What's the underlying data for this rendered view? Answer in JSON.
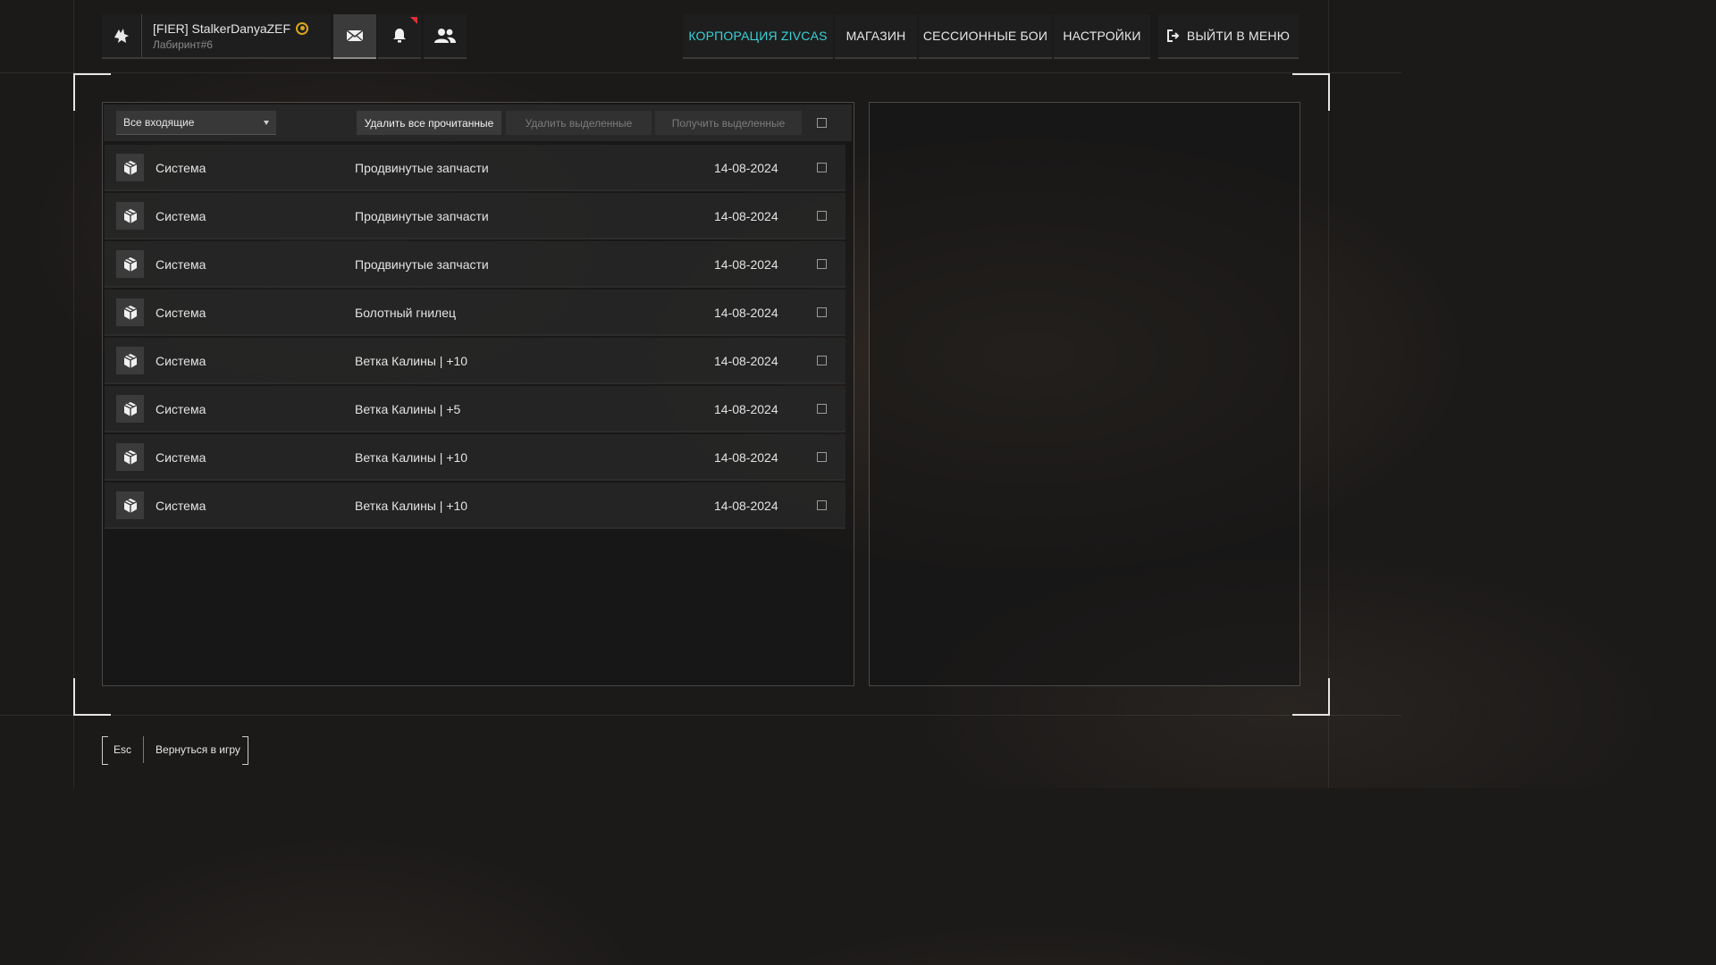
{
  "profile": {
    "name": "[FIER] StalkerDanyaZEF",
    "subtitle": "Лабиринт#6"
  },
  "top_icons": [
    "mail-icon",
    "bell-icon",
    "friends-icon"
  ],
  "nav": {
    "corporation": "КОРПОРАЦИЯ ZIVCAS",
    "shop": "МАГАЗИН",
    "sessions": "СЕССИОННЫЕ БОИ",
    "settings": "НАСТРОЙКИ",
    "exit": "ВЫЙТИ В МЕНЮ"
  },
  "colors": {
    "accent": "#3ad0d6",
    "badge": "#e0303a",
    "gold": "#d9a520"
  },
  "mail": {
    "filter": "Все входящие",
    "delete_read": "Удалить все прочитанные",
    "delete_selected": "Удалить выделенные",
    "claim_selected": "Получить выделенные",
    "items": [
      {
        "sender": "Система",
        "subject": "Продвинутые запчасти",
        "date": "14-08-2024"
      },
      {
        "sender": "Система",
        "subject": "Продвинутые запчасти",
        "date": "14-08-2024"
      },
      {
        "sender": "Система",
        "subject": "Продвинутые запчасти",
        "date": "14-08-2024"
      },
      {
        "sender": "Система",
        "subject": "Болотный гнилец",
        "date": "14-08-2024"
      },
      {
        "sender": "Система",
        "subject": "Ветка Калины | +10",
        "date": "14-08-2024"
      },
      {
        "sender": "Система",
        "subject": "Ветка Калины | +5",
        "date": "14-08-2024"
      },
      {
        "sender": "Система",
        "subject": "Ветка Калины | +10",
        "date": "14-08-2024"
      },
      {
        "sender": "Система",
        "subject": "Ветка Калины | +10",
        "date": "14-08-2024"
      }
    ]
  },
  "footer": {
    "key": "Esc",
    "label": "Вернуться в игру"
  }
}
